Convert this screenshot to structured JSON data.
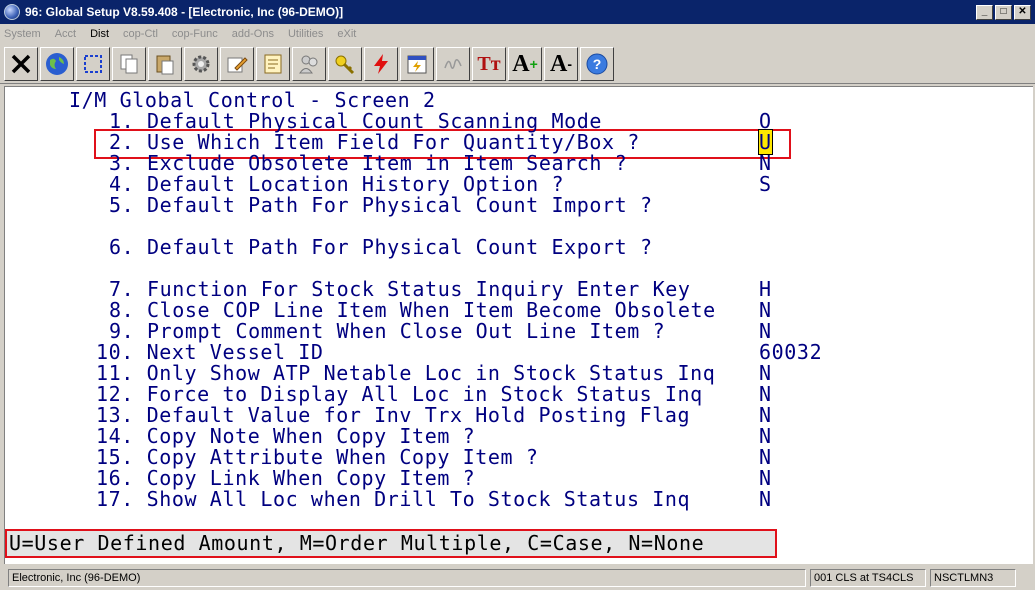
{
  "window": {
    "title": "96: Global Setup V8.59.408 - [Electronic, Inc (96-DEMO)]",
    "minimize": "_",
    "maximize": "□",
    "close": "✕"
  },
  "menu": {
    "items": [
      "System",
      "Acct",
      "Dist",
      "cop-Ctl",
      "cop-Func",
      "add-Ons",
      "Utilities",
      "eXit"
    ]
  },
  "toolbar": {
    "icons": [
      "close-x-icon",
      "globe-icon",
      "select-rectangle-icon",
      "copy-icon",
      "paste-icon",
      "settings-gear-icon",
      "edit-pencil-icon",
      "notes-icon",
      "users-icon",
      "key-icon",
      "lightning-icon",
      "calendar-icon",
      "signature-icon",
      "font-icon",
      "increase-font-icon",
      "decrease-font-icon",
      "help-icon"
    ],
    "glyphs": {
      "tt": "Tт",
      "a_plus": "A",
      "a_minus": "A"
    }
  },
  "screen": {
    "heading": "I/M Global Control - Screen 2",
    "items": [
      {
        "num": "1.",
        "label": "Default Physical Count Scanning Mode",
        "value": "O"
      },
      {
        "num": "2.",
        "label": "Use Which Item Field For Quantity/Box ?",
        "value": "U"
      },
      {
        "num": "3.",
        "label": "Exclude Obsolete Item in Item Search ?",
        "value": "N"
      },
      {
        "num": "4.",
        "label": "Default Location History Option ?",
        "value": "S"
      },
      {
        "num": "5.",
        "label": "Default Path For Physical Count Import ?",
        "value": ""
      },
      {
        "num": "6.",
        "label": "Default Path For Physical Count Export ?",
        "value": ""
      },
      {
        "num": "7.",
        "label": "Function For Stock Status Inquiry Enter Key",
        "value": "H"
      },
      {
        "num": "8.",
        "label": "Close COP Line Item When Item Become Obsolete",
        "value": "N"
      },
      {
        "num": "9.",
        "label": "Prompt Comment When Close Out Line Item ?",
        "value": "N"
      },
      {
        "num": "10.",
        "label": "Next Vessel ID",
        "value": "60032"
      },
      {
        "num": "11.",
        "label": "Only Show ATP Netable Loc in Stock Status Inq",
        "value": "N"
      },
      {
        "num": "12.",
        "label": "Force to Display All Loc in Stock Status Inq",
        "value": "N"
      },
      {
        "num": "13.",
        "label": "Default Value for Inv Trx Hold Posting Flag",
        "value": "N"
      },
      {
        "num": "14.",
        "label": "Copy Note When Copy Item ?",
        "value": "N"
      },
      {
        "num": "15.",
        "label": "Copy Attribute When Copy Item ?",
        "value": "N"
      },
      {
        "num": "16.",
        "label": "Copy Link When Copy Item ?",
        "value": "N"
      },
      {
        "num": "17.",
        "label": "Show All Loc when Drill To Stock Status Inq",
        "value": "N"
      }
    ],
    "help_text": "U=User Defined Amount, M=Order Multiple, C=Case, N=None"
  },
  "colors": {
    "terminal_text": "#000080",
    "highlight": "#e0101a",
    "cursor": "#ffe800"
  },
  "status": {
    "company": "Electronic, Inc (96-DEMO)",
    "session": "001 CLS at TS4CLS",
    "program": "NSCTLMN3"
  }
}
